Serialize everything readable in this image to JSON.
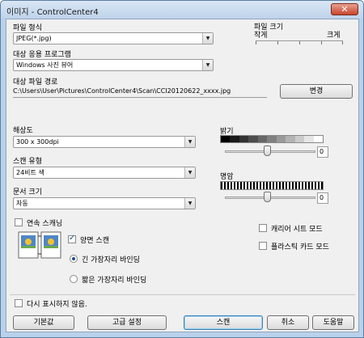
{
  "window": {
    "title": "이미지 - ControlCenter4",
    "close_glyph": "✕"
  },
  "file_type": {
    "label": "파일 형식",
    "value": "JPEG(*.jpg)"
  },
  "file_size": {
    "label": "파일 크기",
    "min_label": "작게",
    "max_label": "크게"
  },
  "target_app": {
    "label": "대상 응용 프로그램",
    "value": "Windows 사진 뷰어"
  },
  "dest_path": {
    "label": "대상 파일 경로",
    "value": "C:\\Users\\User\\Pictures\\ControlCenter4\\Scan\\CCI20120622_xxxx.jpg",
    "change_button": "변경"
  },
  "resolution": {
    "label": "해상도",
    "value": "300 x 300dpi"
  },
  "scan_type": {
    "label": "스캔 유형",
    "value": "24비트 색"
  },
  "doc_size": {
    "label": "문서 크기",
    "value": "자동"
  },
  "brightness": {
    "label": "밝기",
    "value": "0",
    "level": 0.5
  },
  "contrast": {
    "label": "명암",
    "value": "0",
    "level": 0.5
  },
  "continuous_scan": {
    "label": "연속 스캐닝",
    "checked": false
  },
  "duplex": {
    "label": "양면 스캔",
    "checked": true,
    "long_edge": "긴 가장자리 바인딩",
    "short_edge": "짧은 가장자리 바인딩"
  },
  "carrier_sheet": {
    "label": "캐리어 시트 모드"
  },
  "plastic_card": {
    "label": "플라스틱 카드 모드"
  },
  "dont_show": {
    "label": "다시 표시하지 않음."
  },
  "buttons": {
    "default": "기본값",
    "advanced": "고급 설정",
    "scan": "스캔",
    "cancel": "취소",
    "help": "도움말"
  },
  "colors": {
    "titlebar": "#bed3ea",
    "frame": "#b9d1ea",
    "client": "#f0f0f0",
    "close": "#c7462c"
  }
}
